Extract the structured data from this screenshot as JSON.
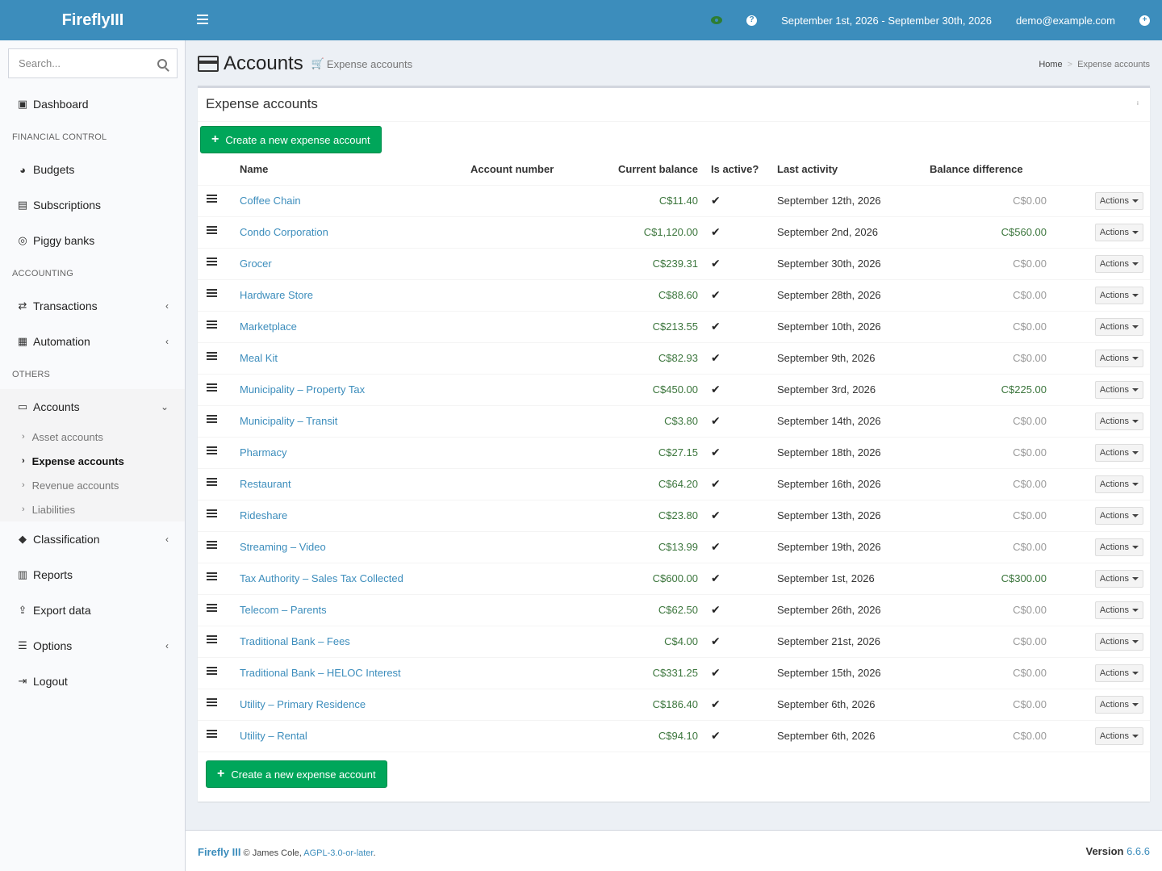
{
  "header": {
    "logo": "FireflyIII",
    "date_range": "September 1st, 2026 - September 30th, 2026",
    "user_email": "demo@example.com"
  },
  "sidebar": {
    "search_placeholder": "Search...",
    "items": {
      "dashboard": "Dashboard",
      "financial_control_header": "FINANCIAL CONTROL",
      "budgets": "Budgets",
      "subscriptions": "Subscriptions",
      "piggy_banks": "Piggy banks",
      "accounting_header": "ACCOUNTING",
      "transactions": "Transactions",
      "automation": "Automation",
      "others_header": "OTHERS",
      "accounts": "Accounts",
      "asset_accounts": "Asset accounts",
      "expense_accounts": "Expense accounts",
      "revenue_accounts": "Revenue accounts",
      "liabilities": "Liabilities",
      "classification": "Classification",
      "reports": "Reports",
      "export_data": "Export data",
      "options": "Options",
      "logout": "Logout"
    }
  },
  "page": {
    "title": "Accounts",
    "subtitle": "Expense accounts",
    "breadcrumb_home": "Home",
    "breadcrumb_current": "Expense accounts"
  },
  "box": {
    "title": "Expense accounts",
    "create_button": "Create a new expense account"
  },
  "table": {
    "headers": {
      "name": "Name",
      "account_number": "Account number",
      "current_balance": "Current balance",
      "is_active": "Is active?",
      "last_activity": "Last activity",
      "balance_difference": "Balance difference"
    },
    "actions_label": "Actions",
    "rows": [
      {
        "name": "Coffee Chain",
        "balance": "C$11.40",
        "last": "September 12th, 2026",
        "diff": "C$0.00",
        "diff_zero": true
      },
      {
        "name": "Condo Corporation",
        "balance": "C$1,120.00",
        "last": "September 2nd, 2026",
        "diff": "C$560.00",
        "diff_zero": false
      },
      {
        "name": "Grocer",
        "balance": "C$239.31",
        "last": "September 30th, 2026",
        "diff": "C$0.00",
        "diff_zero": true
      },
      {
        "name": "Hardware Store",
        "balance": "C$88.60",
        "last": "September 28th, 2026",
        "diff": "C$0.00",
        "diff_zero": true
      },
      {
        "name": "Marketplace",
        "balance": "C$213.55",
        "last": "September 10th, 2026",
        "diff": "C$0.00",
        "diff_zero": true
      },
      {
        "name": "Meal Kit",
        "balance": "C$82.93",
        "last": "September 9th, 2026",
        "diff": "C$0.00",
        "diff_zero": true
      },
      {
        "name": "Municipality – Property Tax",
        "balance": "C$450.00",
        "last": "September 3rd, 2026",
        "diff": "C$225.00",
        "diff_zero": false
      },
      {
        "name": "Municipality – Transit",
        "balance": "C$3.80",
        "last": "September 14th, 2026",
        "diff": "C$0.00",
        "diff_zero": true
      },
      {
        "name": "Pharmacy",
        "balance": "C$27.15",
        "last": "September 18th, 2026",
        "diff": "C$0.00",
        "diff_zero": true
      },
      {
        "name": "Restaurant",
        "balance": "C$64.20",
        "last": "September 16th, 2026",
        "diff": "C$0.00",
        "diff_zero": true
      },
      {
        "name": "Rideshare",
        "balance": "C$23.80",
        "last": "September 13th, 2026",
        "diff": "C$0.00",
        "diff_zero": true
      },
      {
        "name": "Streaming – Video",
        "balance": "C$13.99",
        "last": "September 19th, 2026",
        "diff": "C$0.00",
        "diff_zero": true
      },
      {
        "name": "Tax Authority – Sales Tax Collected",
        "balance": "C$600.00",
        "last": "September 1st, 2026",
        "diff": "C$300.00",
        "diff_zero": false
      },
      {
        "name": "Telecom – Parents",
        "balance": "C$62.50",
        "last": "September 26th, 2026",
        "diff": "C$0.00",
        "diff_zero": true
      },
      {
        "name": "Traditional Bank – Fees",
        "balance": "C$4.00",
        "last": "September 21st, 2026",
        "diff": "C$0.00",
        "diff_zero": true
      },
      {
        "name": "Traditional Bank – HELOC Interest",
        "balance": "C$331.25",
        "last": "September 15th, 2026",
        "diff": "C$0.00",
        "diff_zero": true
      },
      {
        "name": "Utility – Primary Residence",
        "balance": "C$186.40",
        "last": "September 6th, 2026",
        "diff": "C$0.00",
        "diff_zero": true
      },
      {
        "name": "Utility – Rental",
        "balance": "C$94.10",
        "last": "September 6th, 2026",
        "diff": "C$0.00",
        "diff_zero": true
      }
    ]
  },
  "footer": {
    "brand": "Firefly III",
    "copyright": "© James Cole,",
    "license": "AGPL-3.0-or-later",
    "version_label": "Version",
    "version": "6.6.6"
  },
  "colors": {
    "header_bg": "#3c8dbc",
    "success_green": "#00a65a",
    "positive_amount": "#3c763d",
    "zero_amount": "#999999"
  },
  "icons": {
    "check": "check-icon",
    "drag": "drag-handle-icon",
    "menu": "hamburger-icon"
  }
}
